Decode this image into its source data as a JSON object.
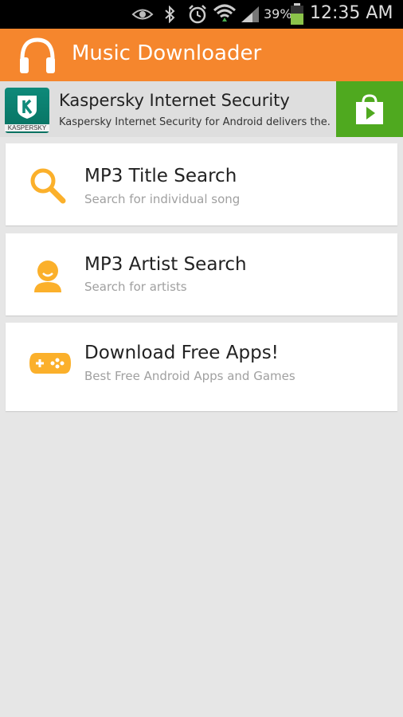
{
  "status_bar": {
    "battery_percent": "39%",
    "time": "12:35 AM",
    "icons": [
      "eye-icon",
      "bluetooth-icon",
      "alarm-icon",
      "wifi-icon",
      "signal-icon",
      "battery-icon"
    ]
  },
  "app_bar": {
    "title": "Music Downloader",
    "icon": "headphones-icon",
    "color": "#f5862d"
  },
  "ad": {
    "logo_text": "KASPERSKY",
    "title": "Kaspersky Internet Security",
    "description": "Kaspersky Internet Security for Android delivers the...",
    "install_icon": "play-store-bag-icon",
    "install_color": "#4fa91f"
  },
  "menu": {
    "items": [
      {
        "title": "MP3 Title Search",
        "subtitle": "Search for individual song",
        "icon": "magnifier-icon"
      },
      {
        "title": "MP3 Artist Search",
        "subtitle": "Search for artists",
        "icon": "person-icon"
      },
      {
        "title": "Download Free Apps!",
        "subtitle": "Best Free Android Apps and Games",
        "icon": "gamepad-icon"
      }
    ],
    "icon_color": "#fbb02b"
  }
}
